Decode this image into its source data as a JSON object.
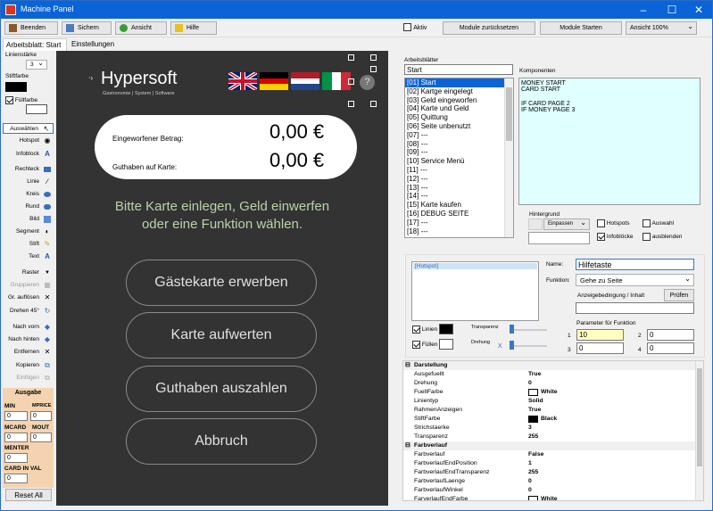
{
  "window": {
    "title": "Machine Panel"
  },
  "toolbar": {
    "beenden": "Beenden",
    "sichern": "Sichern",
    "ansicht": "Ansicht",
    "hilfe": "Hilfe",
    "aktiv_label": "Aktiv",
    "module_reset": "Module zurücksetzen",
    "module_start": "Module Starten",
    "zoom_value": "Ansicht 100%"
  },
  "tabs": {
    "arbeitsblatt": "Arbeitsblatt: Start",
    "einstellungen": "Einstellungen"
  },
  "left": {
    "linienstaerke_label": "Linienstärke",
    "linienstaerke_value": "3",
    "stiftfarbe_label": "Stiftfarbe",
    "fuellfarbe_label": "Füllfarbe",
    "tools": [
      "Auswählen",
      "Hotspot",
      "Infoblock",
      "Rechteck",
      "Linie",
      "Kreis",
      "Rund",
      "Bild",
      "Segment",
      "Stift",
      "Text",
      "Raster",
      "Gruppieren",
      "Gr. auflösen",
      "Drehen 45°",
      "Nach vorn",
      "Nach hinten",
      "Entfernen",
      "Kopieren",
      "Einfügen"
    ],
    "ausgabe": {
      "title": "Ausgabe",
      "min_label": "MIN",
      "mprice_label": "MPRICE",
      "min_value": "0",
      "mprice_value": "0",
      "mcard_label": "MCARD",
      "mout_label": "MOUT",
      "mcard_value": "0",
      "mout_value": "0",
      "menter_label": "MENTER",
      "menter_value": "0",
      "cardinval_label": "CARD IN VAL",
      "cardinval_value": "0",
      "reset": "Reset All"
    }
  },
  "screen": {
    "logo": "Hypersoft",
    "logo_sub": "Gastronomie | System | Software",
    "betrag_label": "Eingeworfener Betrag:",
    "betrag_value": "0,00 €",
    "guthaben_label": "Guthaben auf Karte:",
    "guthaben_value": "0,00 €",
    "prompt_line1": "Bitte Karte einlegen, Geld einwerfen",
    "prompt_line2": "oder eine Funktion wählen.",
    "buttons": [
      "Gästekarte erwerben",
      "Karte aufwerten",
      "Guthaben auszahlen",
      "Abbruch"
    ]
  },
  "arbeitsblaetter": {
    "label": "Arbeitsblätter",
    "current": "Start",
    "items": [
      "[01] Start",
      "[02] Kartge eingelegt",
      "[03] Geld eingeworfen",
      "[04] Karte und Geld",
      "[05] Quittung",
      "[06] Seite unbenutzt",
      "[07] ---",
      "[08] ---",
      "[09] ---",
      "[10] Service Menü",
      "[11] ---",
      "[12] ---",
      "[13] ---",
      "[14] ---",
      "[15] Karte kaufen",
      "[16] DEBUG SEITE",
      "[17] ---",
      "[18] ---"
    ]
  },
  "komponenten": {
    "label": "Komponenten",
    "lines": [
      "MONEY START",
      "CARD START",
      "",
      "IF CARD PAGE 2",
      "IF MONEY PAGE 3"
    ]
  },
  "hintergrund": {
    "label": "Hintergrund",
    "mode": "Einpassen",
    "hotspots": "Hotspots",
    "auswahl": "Auswahl",
    "infobloecke": "Infoblöcke",
    "ausblenden": "ausblenden"
  },
  "hotspot": {
    "item": "[Hotspot]",
    "name_label": "Name:",
    "name_value": "Hilfetaste",
    "funktion_label": "Funktion:",
    "funktion_value": "Gehe zu Seite",
    "anzeige_label": "Anzeigebedingung / Inhalt",
    "pruefen": "Prüfen",
    "linien": "Linien",
    "fuellen": "Füllen",
    "transparenz": "Transparenz",
    "drehung": "Drehung",
    "x": "X",
    "param_label": "Parameter für Funktion",
    "p1": "1",
    "p2": "2",
    "p3": "3",
    "p4": "4",
    "v1": "10",
    "v2": "0",
    "v3": "0",
    "v4": "0"
  },
  "props": {
    "darstellung": "Darstellung",
    "farbverlauf": "Farbverlauf",
    "rows1": [
      [
        "Ausgefuellt",
        "True"
      ],
      [
        "Drehung",
        "0"
      ],
      [
        "FuellFarbe",
        "White"
      ],
      [
        "Linientyp",
        "Solid"
      ],
      [
        "RahmenAnzeigen",
        "True"
      ],
      [
        "StiftFarbe",
        "Black"
      ],
      [
        "Strichstaerke",
        "3"
      ],
      [
        "Transparenz",
        "255"
      ]
    ],
    "rows2": [
      [
        "Farbverlauf",
        "False"
      ],
      [
        "FarbverlaufEndPosition",
        "1"
      ],
      [
        "FarbverlaufEndTransparenz",
        "255"
      ],
      [
        "FarbverlaufLaenge",
        "0"
      ],
      [
        "FarbverlaufWinkel",
        "0"
      ],
      [
        "FarverlaufEndFarbe",
        "White"
      ]
    ]
  }
}
